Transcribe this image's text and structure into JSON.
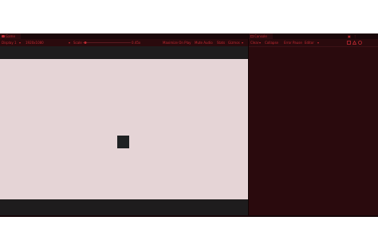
{
  "game_panel": {
    "tab_icon": "game-controller-icon",
    "tab_label": "Game",
    "display_dropdown": "Display 1",
    "resolution_dropdown": "1920x1080",
    "scale_label": "Scale",
    "scale_value": "0.45x",
    "maximize_label": "Maximize On Play",
    "mute_label": "Mute Audio",
    "stats_label": "Stats",
    "gizmos_label": "Gizmos"
  },
  "console_panel": {
    "tab_icon": "console-icon",
    "tab_label": "Console",
    "clear_label": "Clear",
    "collapse_label": "Collapse",
    "error_pause_label": "Error Pause",
    "editor_dropdown": "Editor"
  },
  "colors": {
    "editor_bg": "#2a0a0d",
    "accent_text": "#c22a32",
    "game_view_bg": "#e5d4d6",
    "object_color": "#1f2123"
  }
}
